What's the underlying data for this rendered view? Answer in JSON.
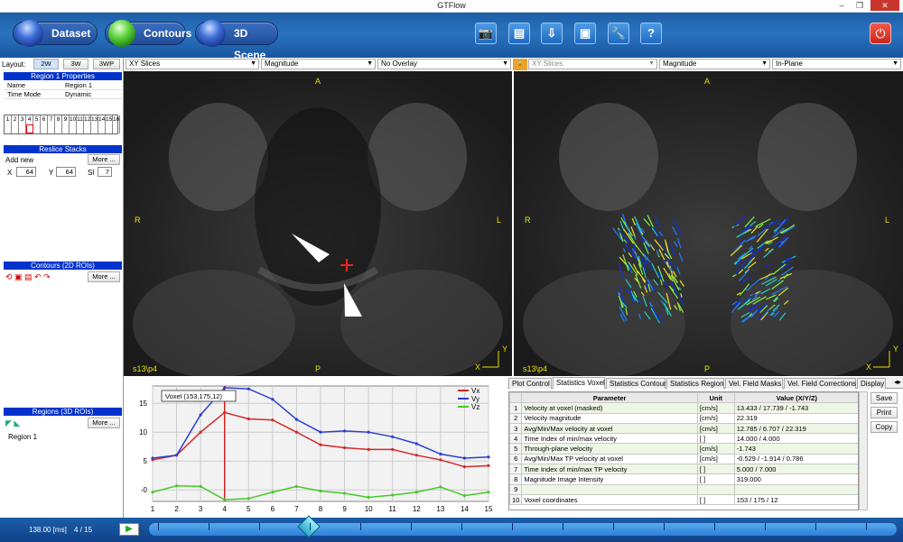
{
  "window": {
    "title": "GTFlow",
    "min": "–",
    "max": "❐",
    "close": "✕"
  },
  "nav": {
    "dataset": "Dataset",
    "contours": "Contours",
    "scene3d": "3D Scene"
  },
  "tools": {
    "camera": "📷",
    "film": "▤",
    "save_down": "⇩",
    "save": "▣",
    "wrench": "🔧",
    "help": "?",
    "power": "⏻"
  },
  "layout": {
    "label": "Layout:",
    "opts": [
      "2W",
      "3W",
      "3WP"
    ]
  },
  "region_props": {
    "title": "Region 1 Properties",
    "rows": [
      {
        "k": "Name",
        "v": "Region 1"
      },
      {
        "k": "Time Mode",
        "v": "Dynamic"
      }
    ]
  },
  "frames": [
    "1",
    "2",
    "3",
    "4",
    "5",
    "6",
    "7",
    "8",
    "9",
    "10",
    "11",
    "12",
    "13",
    "14",
    "15",
    "16"
  ],
  "reslice": {
    "title": "Reslice Stacks",
    "add": "Add new",
    "more": "More ...",
    "x_label": "X",
    "x": "64",
    "y_label": "Y",
    "y": "64",
    "sl_label": "Sl",
    "sl": "7"
  },
  "contours": {
    "title": "Contours (2D ROIs)",
    "more": "More ..."
  },
  "regions": {
    "title": "Regions (3D ROIs)",
    "more": "More ...",
    "items": [
      "Region 1"
    ]
  },
  "left_view": {
    "dd1": "XY Slices",
    "dd2": "Magnitude",
    "dd3": "No Overlay",
    "top": "A",
    "bottom": "P",
    "left": "R",
    "right": "L",
    "slice": "s13\\p4",
    "axis_x": "X",
    "axis_y": "Y"
  },
  "right_view": {
    "dd1": "XY Slices",
    "dd2": "Magnitude",
    "dd3": "In-Plane",
    "top": "A",
    "bottom": "P",
    "left": "R",
    "right": "L",
    "slice": "s13\\p4",
    "axis_x": "X",
    "axis_y": "Y"
  },
  "chart_data": {
    "type": "line",
    "annotation": "Voxel (153,175,12)",
    "x": [
      1,
      2,
      3,
      4,
      5,
      6,
      7,
      8,
      9,
      10,
      11,
      12,
      13,
      14,
      15
    ],
    "ylim": [
      -2,
      18
    ],
    "yticks": [
      "-0",
      "5",
      "10",
      "15"
    ],
    "series": [
      {
        "name": "Vx",
        "color": "#d42a2a",
        "values": [
          5.2,
          6.0,
          10.0,
          13.4,
          12.3,
          12.1,
          10.0,
          7.8,
          7.3,
          7.0,
          7.0,
          6.0,
          5.2,
          4.0,
          4.2
        ]
      },
      {
        "name": "Vy",
        "color": "#2a3fd4",
        "values": [
          5.5,
          6.0,
          13.0,
          17.7,
          17.5,
          15.7,
          12.2,
          10.0,
          10.2,
          10.0,
          9.2,
          8.0,
          6.2,
          5.5,
          5.7
        ]
      },
      {
        "name": "Vz",
        "color": "#48c92a",
        "values": [
          -0.4,
          0.7,
          0.6,
          -1.7,
          -1.5,
          -0.4,
          0.6,
          -0.2,
          -0.6,
          -1.3,
          -0.9,
          -0.4,
          0.5,
          -1.0,
          -0.4
        ]
      }
    ],
    "cursor_x": 4
  },
  "stats_tabs": [
    "Plot Control",
    "Statistics Voxel",
    "Statistics Contour",
    "Statistics Region",
    "Vel. Field Masks",
    "Vel. Field Corrections",
    "Display"
  ],
  "stats": {
    "headers": [
      "Parameter",
      "Unit",
      "Value (X/Y/Z)"
    ],
    "rows": [
      {
        "n": "1",
        "p": "Velocity at voxel (masked)",
        "u": "[cm/s]",
        "v": "13.433 / 17.739 / -1.743"
      },
      {
        "n": "2",
        "p": "Velocity magnitude",
        "u": "[cm/s]",
        "v": "22.319"
      },
      {
        "n": "3",
        "p": "Avg/Min/Max velocity at voxel",
        "u": "[cm/s]",
        "v": "12.785 / 6.707 / 22.319"
      },
      {
        "n": "4",
        "p": "Time Index of min/max velocity",
        "u": "[ ]",
        "v": "14.000 / 4.000"
      },
      {
        "n": "5",
        "p": "Through-plane velocity",
        "u": "[cm/s]",
        "v": "-1.743"
      },
      {
        "n": "6",
        "p": "Avg/Min/Max TP velocity at voxel",
        "u": "[cm/s]",
        "v": "-0.529 / -1.914 / 0.786"
      },
      {
        "n": "7",
        "p": "Time Index of min/max TP velocity",
        "u": "[ ]",
        "v": "5.000 / 7.000"
      },
      {
        "n": "8",
        "p": "Magnitude Image Intensity",
        "u": "[ ]",
        "v": "319.000"
      },
      {
        "n": "9",
        "p": "",
        "u": "",
        "v": ""
      },
      {
        "n": "10",
        "p": "Voxel coordinates",
        "u": "[ ]",
        "v": "153 / 175 / 12"
      }
    ]
  },
  "side_buttons": [
    "Save",
    "Print",
    "Copy"
  ],
  "playback": {
    "time": "138.00 [ms]",
    "frame": "4 / 15",
    "play": "▶"
  }
}
